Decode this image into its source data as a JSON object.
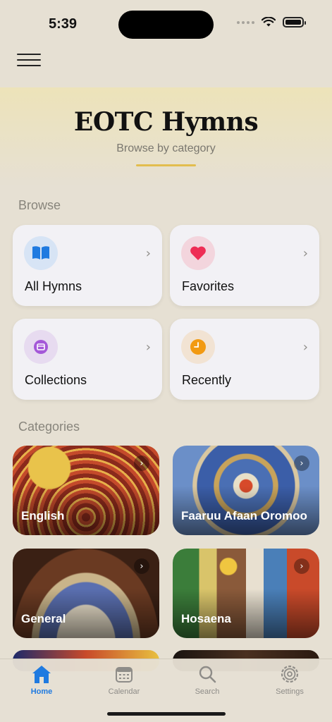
{
  "status_bar": {
    "time": "5:39"
  },
  "header": {
    "title": "EOTC Hymns",
    "subtitle": "Browse by category"
  },
  "browse": {
    "section_label": "Browse",
    "items": [
      {
        "label": "All Hymns",
        "icon": "book-icon",
        "color": "#1f7ae0",
        "bg": "#d7e4f5"
      },
      {
        "label": "Favorites",
        "icon": "heart-icon",
        "color": "#ee2d55",
        "bg": "#f3d5dd"
      },
      {
        "label": "Collections",
        "icon": "folder-icon",
        "color": "#a458d8",
        "bg": "#e7dbf0"
      },
      {
        "label": "Recently",
        "icon": "clock-icon",
        "color": "#f29a12",
        "bg": "#f2e3d3"
      }
    ]
  },
  "categories": {
    "section_label": "Categories",
    "items": [
      {
        "label": "English"
      },
      {
        "label": "Faaruu Afaan Oromoo"
      },
      {
        "label": "General"
      },
      {
        "label": "Hosaena"
      }
    ]
  },
  "tab_bar": {
    "items": [
      {
        "label": "Home",
        "icon": "house-icon",
        "active": true
      },
      {
        "label": "Calendar",
        "icon": "calendar-icon",
        "active": false
      },
      {
        "label": "Search",
        "icon": "search-icon",
        "active": false
      },
      {
        "label": "Settings",
        "icon": "gear-icon",
        "active": false
      }
    ]
  },
  "colors": {
    "accent": "#1f7ae0",
    "underline": "#e2bd4e",
    "background": "#e6e0d3"
  }
}
